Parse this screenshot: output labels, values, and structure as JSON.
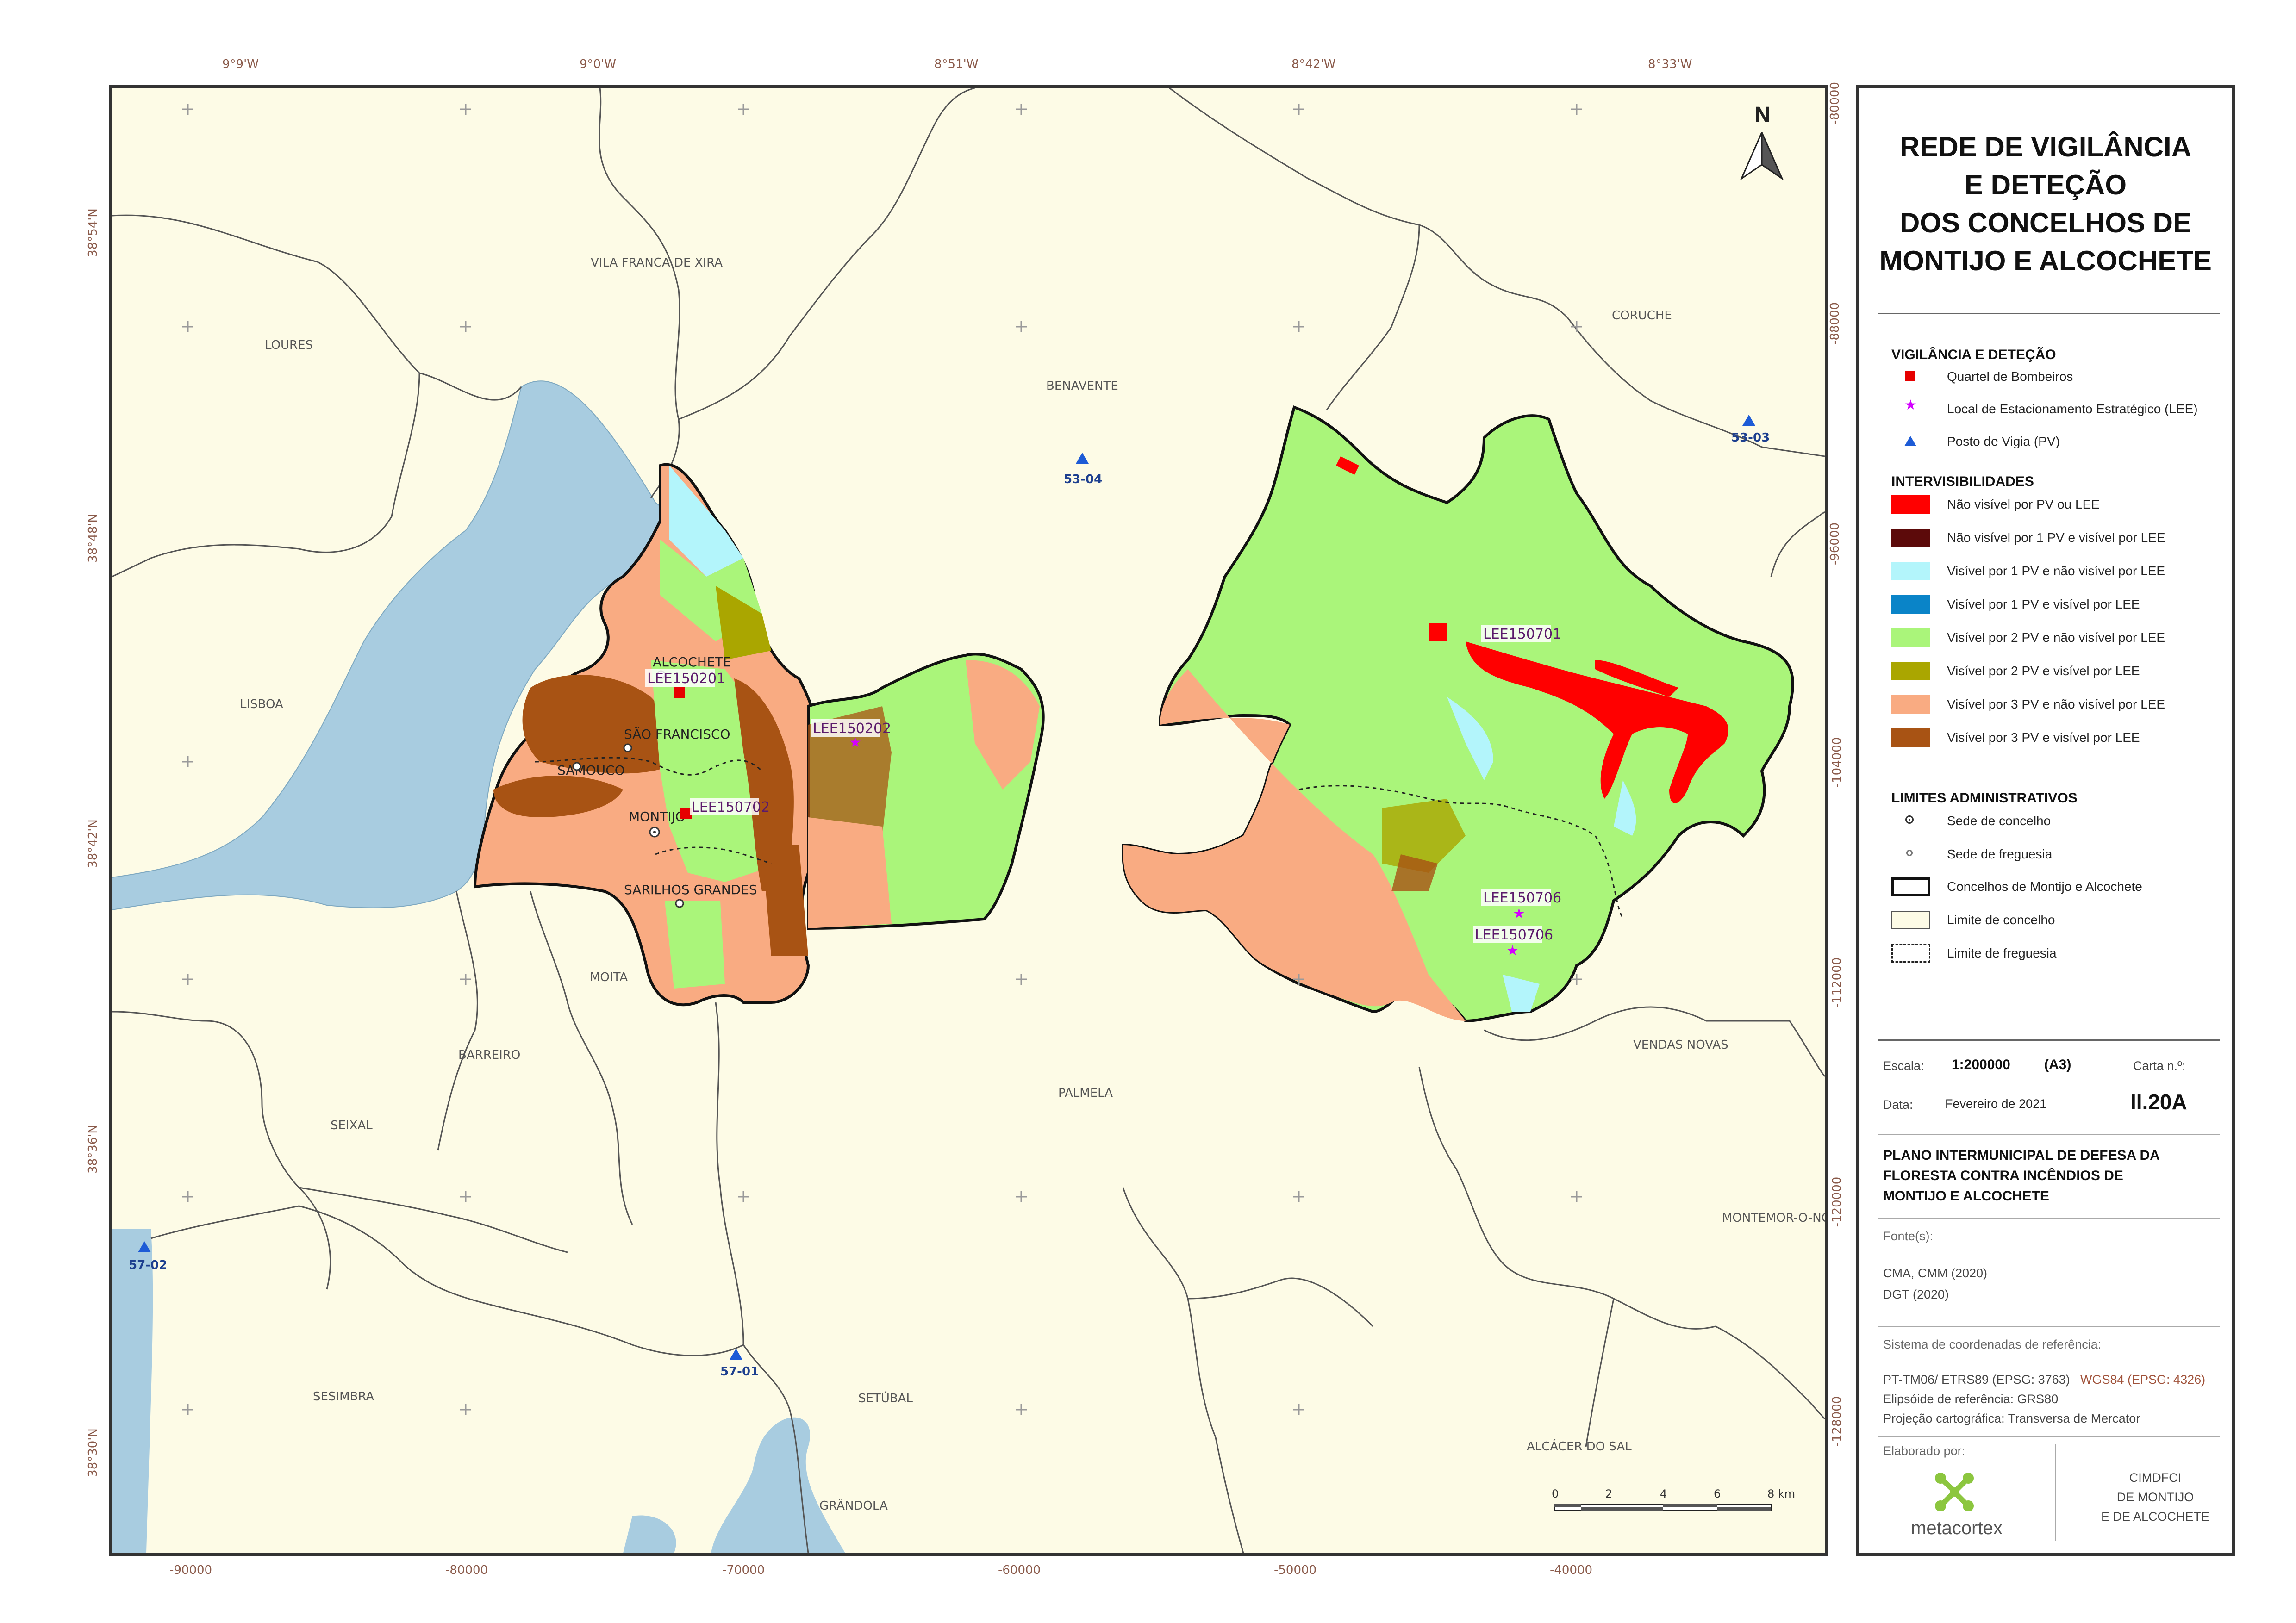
{
  "graticule": {
    "top_lon": [
      "9°9'W",
      "9°0'W",
      "8°51'W",
      "8°42'W",
      "8°33'W"
    ],
    "left_lat": [
      "38°54'N",
      "38°48'N",
      "38°42'N",
      "38°36'N",
      "38°30'N"
    ],
    "bottom_x": [
      "-90000",
      "-80000",
      "-70000",
      "-60000",
      "-50000",
      "-40000"
    ],
    "right_y": [
      "-80000",
      "-88000",
      "-96000",
      "-104000",
      "-112000",
      "-120000",
      "-128000"
    ]
  },
  "map": {
    "north_label": "N",
    "places": {
      "vila_franca": "VILA FRANCA DE XIRA",
      "loures": "LOURES",
      "benavente": "BENAVENTE",
      "coruche": "CORUCHE",
      "lisboa": "LISBOA",
      "moita": "MOITA",
      "barreiro": "BARREIRO",
      "seixal": "SEIXAL",
      "palmela": "PALMELA",
      "vendas_novas": "VENDAS NOVAS",
      "montemor": "MONTEMOR-O-NO",
      "sesimbra": "SESIMBRA",
      "setubal": "SETÚBAL",
      "alcacer": "ALCÁCER DO SAL",
      "grandola": "GRÂNDOLA"
    },
    "towns": {
      "alcochete": "ALCOCHETE",
      "sao_francisco": "SÃO FRANCISCO",
      "samouco": "SAMOUCO",
      "montijo": "MONTIJO",
      "sarilhos": "SARILHOS GRANDES"
    },
    "lee": {
      "lee150201": "LEE150201",
      "lee150202": "LEE150202",
      "lee150702": "LEE150702",
      "lee150701": "LEE150701",
      "lee150706a": "LEE150706",
      "lee150706b": "LEE150706"
    },
    "pv": {
      "p5304": "53-04",
      "p5303": "53-03",
      "p5702": "57-02",
      "p5701": "57-01"
    },
    "scale_ticks": [
      "0",
      "2",
      "4",
      "6",
      "8 km"
    ]
  },
  "panel": {
    "title_lines": [
      "REDE DE VIGILÂNCIA",
      "E DETEÇÃO",
      "DOS CONCELHOS DE",
      "MONTIJO E ALCOCHETE"
    ],
    "section_vigilancia": "VIGILÂNCIA E DETEÇÃO",
    "vigilancia_items": [
      "Quartel de Bombeiros",
      "Local de Estacionamento Estratégico (LEE)",
      "Posto de Vigia (PV)"
    ],
    "section_intervisibilidades": "INTERVISIBILIDADES",
    "intervis_items": [
      {
        "label": "Não visível por PV ou LEE",
        "color": "#ff0000"
      },
      {
        "label": "Não visível por 1 PV e visível por LEE",
        "color": "#5c0a0a"
      },
      {
        "label": "Visível por 1 PV e não visível por LEE",
        "color": "#b3f5fb"
      },
      {
        "label": "Visível por 1 PV e visível por LEE",
        "color": "#0a84c8"
      },
      {
        "label": "Visível por 2 PV e não visível por LEE",
        "color": "#aaf57a"
      },
      {
        "label": "Visível por 2 PV e visível por LEE",
        "color": "#aaa600"
      },
      {
        "label": "Visível por 3 PV e não visível por LEE",
        "color": "#f9ab82"
      },
      {
        "label": "Visível por 3 PV e visível por LEE",
        "color": "#a85314"
      }
    ],
    "section_limites": "LIMITES ADMINISTRATIVOS",
    "limites_items": [
      "Sede de concelho",
      "Sede de freguesia",
      "Concelhos de Montijo e Alcochete",
      "Limite de concelho",
      "Limite de freguesia"
    ],
    "escala_label": "Escala:",
    "escala_value": "1:200000",
    "escala_format": "(A3)",
    "carta_label": "Carta n.º:",
    "data_label": "Data:",
    "data_value": "Fevereiro de 2021",
    "carta_value": "II.20A",
    "plano_lines": [
      "PLANO INTERMUNICIPAL DE DEFESA DA",
      "FLORESTA CONTRA INCÊNDIOS DE",
      "MONTIJO E ALCOCHETE"
    ],
    "fontes_label": "Fonte(s):",
    "fontes_lines": [
      "CMA, CMM (2020)",
      "DGT (2020)"
    ],
    "sistema_label": "Sistema de coordenadas de referência:",
    "sistema_value": "PT-TM06/ ETRS89 (EPSG: 3763)",
    "sistema_wgs": "WGS84 (EPSG: 4326)",
    "elipsoide": "Elipsóide de referência: GRS80",
    "projecao": "Projeção cartográfica: Transversa de Mercator",
    "elaborado_label": "Elaborado por:",
    "metacortex": "metacortex",
    "cimdfci_lines": [
      "CIMDFCI",
      "DE MONTIJO",
      "E DE ALCOCHETE"
    ]
  }
}
